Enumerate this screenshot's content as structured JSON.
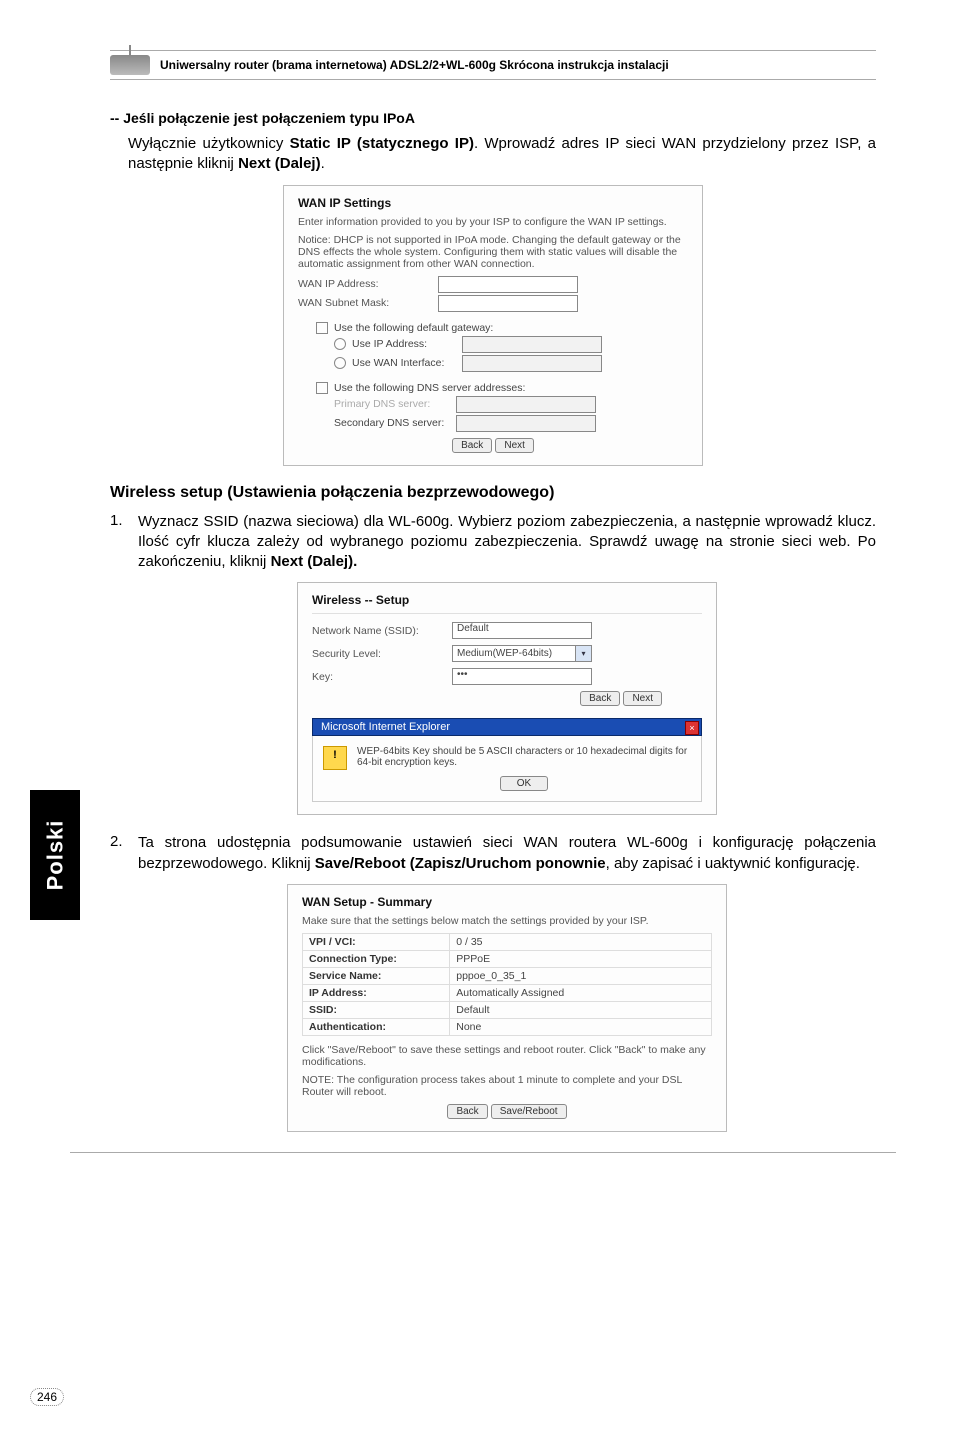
{
  "header": {
    "title": "Uniwersalny router (brama internetowa) ADSL2/2+WL-600g  Skrócona instrukcja instalacji"
  },
  "sidetab": "Polski",
  "pagenum": "246",
  "sec1": {
    "heading": "-- Jeśli połączenie jest połączeniem typu IPoA",
    "p_pre": "Wyłącznie użytkownicy ",
    "p_b1": "Static IP (statycznego IP)",
    "p_mid": ". Wprowadź adres IP sieci WAN przydzielony przez ISP, a następnie kliknij ",
    "p_b2": "Next (Dalej)",
    "p_end": "."
  },
  "shot1": {
    "title": "WAN IP Settings",
    "p1": "Enter information provided to you by your ISP to configure the WAN IP settings.",
    "p2": "Notice: DHCP is not supported in IPoA mode. Changing the default gateway or the DNS effects the whole system. Configuring them with static values will disable the automatic assignment from other WAN connection.",
    "l_wanip": "WAN IP Address:",
    "l_mask": "WAN Subnet Mask:",
    "c_gw": "Use the following default gateway:",
    "r_ip": "Use IP Address:",
    "r_wanif": "Use WAN Interface:",
    "wanif_val": "",
    "c_dns": "Use the following DNS server addresses:",
    "l_pdns": "Primary DNS server:",
    "l_sdns": "Secondary DNS server:",
    "btn_back": "Back",
    "btn_next": "Next"
  },
  "sec2": {
    "heading": "Wireless setup (Ustawienia połączenia bezprzewodowego)",
    "li1_pre": "Wyznacz SSID (nazwa sieciowa) dla WL-600g. Wybierz poziom zabezpieczenia, a następnie wprowadź klucz. Ilość cyfr klucza zależy od wybranego poziomu zabezpieczenia. Sprawdź uwagę na stronie sieci web. Po zakończeniu, kliknij ",
    "li1_b": "Next (Dalej).",
    "li2_pre": "Ta strona udostępnia podsumowanie ustawień sieci WAN routera WL-600g i konfigurację połączenia bezprzewodowego. Kliknij ",
    "li2_b": "Save/Reboot (Zapisz/Uruchom ponownie",
    "li2_end": ", aby zapisać i uaktywnić konfigurację."
  },
  "shot2": {
    "title": "Wireless -- Setup",
    "l_ssid": "Network Name (SSID):",
    "v_ssid": "Default",
    "l_sec": "Security Level:",
    "v_sec": "Medium(WEP-64bits)",
    "l_key": "Key:",
    "v_key": "•••",
    "btn_back": "Back",
    "btn_next": "Next",
    "dlg_title": "Microsoft Internet Explorer",
    "dlg_msg": "WEP-64bits Key should be 5 ASCII characters or 10 hexadecimal digits for 64-bit encryption keys.",
    "dlg_ok": "OK"
  },
  "shot3": {
    "title": "WAN Setup - Summary",
    "p1": "Make sure that the settings below match the settings provided by your ISP.",
    "rows": [
      [
        "VPI / VCI:",
        "0 / 35"
      ],
      [
        "Connection Type:",
        "PPPoE"
      ],
      [
        "Service Name:",
        "pppoe_0_35_1"
      ],
      [
        "IP Address:",
        "Automatically Assigned"
      ],
      [
        "SSID:",
        "Default"
      ],
      [
        "Authentication:",
        "None"
      ]
    ],
    "p2": "Click \"Save/Reboot\" to save these settings and reboot router. Click \"Back\" to make any modifications.",
    "p3": "NOTE: The configuration process takes about 1 minute to complete and your DSL Router will reboot.",
    "btn_back": "Back",
    "btn_save": "Save/Reboot"
  }
}
